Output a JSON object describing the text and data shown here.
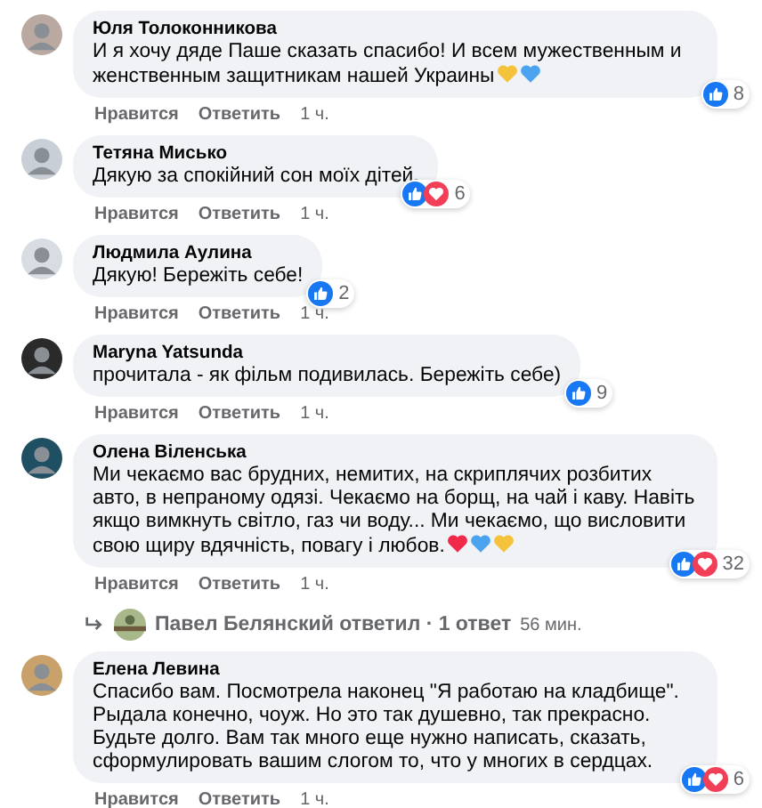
{
  "comments": [
    {
      "author": "Юля Толоконникова",
      "text": "И я хочу дяде Паше сказать спасибо! И всем мужественным и женственным защитникам нашей Украины",
      "hearts": [
        {
          "color": "#f5c33b"
        },
        {
          "color": "#4ba3f0"
        }
      ],
      "reactions": [
        {
          "kind": "like"
        }
      ],
      "reaction_count": "8",
      "actions": [
        "Нравится",
        "Ответить"
      ],
      "time": "1 ч."
    },
    {
      "author": "Тетяна Мисько",
      "text": "Дякую за спокійний сон моїх дітей.",
      "reactions": [
        {
          "kind": "like"
        },
        {
          "kind": "love"
        }
      ],
      "reaction_count": "6",
      "actions": [
        "Нравится",
        "Ответить"
      ],
      "time": "1 ч."
    },
    {
      "author": "Людмила Аулина",
      "text": "Дякую! Бережіть себе!",
      "reactions": [
        {
          "kind": "like"
        }
      ],
      "reaction_count": "2",
      "actions": [
        "Нравится",
        "Ответить"
      ],
      "time": "1 ч."
    },
    {
      "author": "Maryna Yatsunda",
      "text": "прочитала - як фільм подивилась. Бережіть себе)",
      "reactions": [
        {
          "kind": "like"
        }
      ],
      "reaction_count": "9",
      "actions": [
        "Нравится",
        "Ответить"
      ],
      "time": "1 ч."
    },
    {
      "author": "Олена Віленська",
      "text": "Ми чекаємо вас брудних, немитих, на скриплячих розбитих авто, в непраному одязі. Чекаємо на борщ, на чай і каву. Навіть якщо вимкнуть світло, газ чи воду... Ми чекаємо, що висловити свою щиру вдячність, повагу і любов.",
      "hearts": [
        {
          "color": "#f02849"
        },
        {
          "color": "#4ba3f0"
        },
        {
          "color": "#f5c33b"
        }
      ],
      "reactions": [
        {
          "kind": "like"
        },
        {
          "kind": "love"
        }
      ],
      "reaction_count": "32",
      "actions": [
        "Нравится",
        "Ответить"
      ],
      "time": "1 ч.",
      "reply": {
        "text": "Павел Белянский ответил · 1 ответ",
        "time": "56 мин."
      }
    },
    {
      "author": "Елена Левина",
      "text": "Спасибо вам. Посмотрела наконец \"Я работаю на кладбище\". Рыдала конечно, чоуж. Но это так душевно, так прекрасно. Будьте долго. Вам так много еще нужно написать, сказать, сформулировать вашим слогом то, что у многих в сердцах.",
      "reactions": [
        {
          "kind": "like"
        },
        {
          "kind": "love"
        }
      ],
      "reaction_count": "6",
      "actions": [
        "Нравится",
        "Ответить"
      ],
      "time": "1 ч."
    }
  ]
}
